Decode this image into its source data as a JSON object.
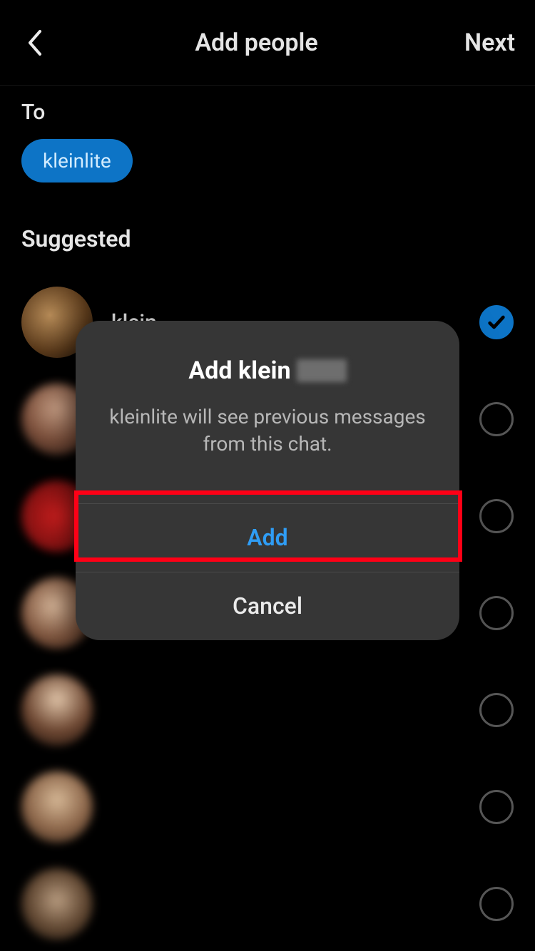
{
  "header": {
    "title": "Add people",
    "next": "Next"
  },
  "to": {
    "label": "To",
    "chip": "kleinlite"
  },
  "suggested": {
    "header": "Suggested",
    "users": [
      {
        "name": "klein",
        "selected": true
      },
      {
        "name": "",
        "selected": false
      },
      {
        "name": "",
        "selected": false
      },
      {
        "name": "",
        "selected": false
      },
      {
        "name": "",
        "selected": false
      },
      {
        "name": "",
        "selected": false
      },
      {
        "name": "",
        "selected": false
      }
    ]
  },
  "dialog": {
    "title_prefix": "Add klein",
    "message": "kleinlite will see previous messages from this chat.",
    "add": "Add",
    "cancel": "Cancel"
  }
}
